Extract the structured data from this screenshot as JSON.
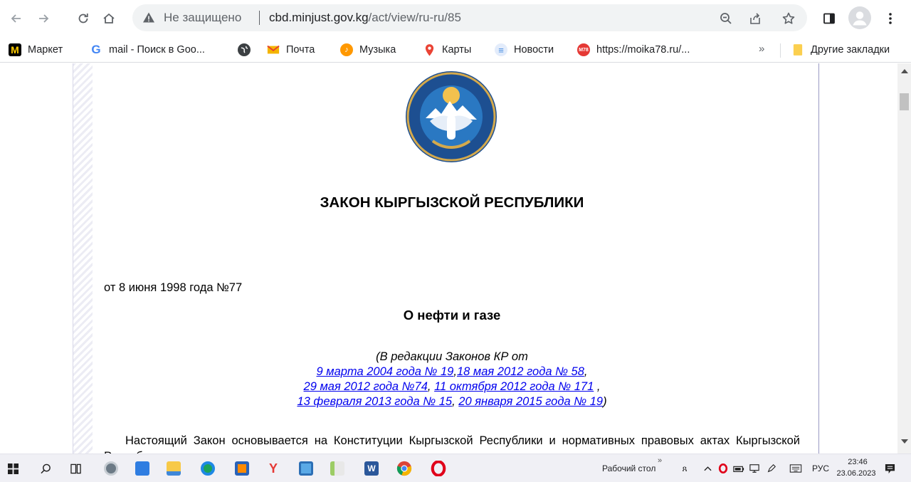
{
  "browser": {
    "security_label": "Не защищено",
    "url_host": "cbd.minjust.gov.kg",
    "url_path": "/act/view/ru-ru/85"
  },
  "bookmarks": {
    "items": [
      {
        "label": "Маркет",
        "icon": "yandex-market-icon",
        "color": "#ffcc00"
      },
      {
        "label": "mail - Поиск в Goo...",
        "icon": "google-icon",
        "color": "#4285f4"
      },
      {
        "label": "",
        "icon": "globe-icon",
        "color": "#3c4043"
      },
      {
        "label": "Почта",
        "icon": "mail-envelope-icon",
        "color": "#f4b400"
      },
      {
        "label": "Музыка",
        "icon": "music-icon",
        "color": "#ff9800"
      },
      {
        "label": "Карты",
        "icon": "map-pin-icon",
        "color": "#ea4335"
      },
      {
        "label": "Новости",
        "icon": "news-icon",
        "color": "#4a90e2"
      },
      {
        "label": "https://moika78.ru/...",
        "icon": "moika78-icon",
        "color": "#e53935"
      }
    ],
    "more": "»",
    "other_label": "Другие закладки"
  },
  "document": {
    "title": "ЗАКОН КЫРГЫЗСКОЙ РЕСПУБЛИКИ",
    "date": "от 8 июня 1998 года №77",
    "subject": "О нефти и газе",
    "edition_intro": "(В редакции Законов КР от",
    "edition_links": [
      "9 марта 2004 года № 19",
      "18 мая 2012 года № 58",
      "29 мая 2012 года №74",
      "11 октября 2012 года № 171",
      "13 февраля 2013 года № 15",
      "20 января 2015 года № 19"
    ],
    "edition_close": ")",
    "preamble": "Настоящий Закон основывается на Конституции Кыргызской Республики и нормативных правовых актах Кыргызской Республики."
  },
  "taskbar": {
    "desktop_label": "Рабочий стол",
    "more": "»",
    "language": "РУС",
    "time": "23:46",
    "date": "23.06.2023"
  }
}
